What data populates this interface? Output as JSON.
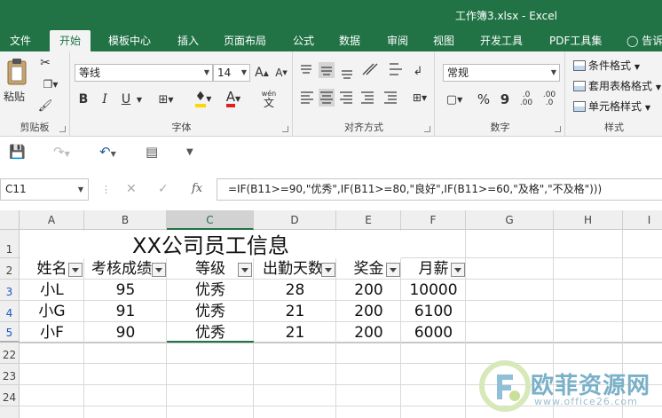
{
  "window": {
    "title": "工作簿3.xlsx - Excel"
  },
  "ribbon_tabs": [
    "文件",
    "开始",
    "模板中心",
    "插入",
    "页面布局",
    "公式",
    "数据",
    "审阅",
    "视图",
    "开发工具",
    "PDF工具集"
  ],
  "tell_me": "告诉",
  "clipboard": {
    "paste_label": "粘贴",
    "group_label": "剪贴板"
  },
  "font": {
    "name": "等线",
    "size": "14",
    "bold": "B",
    "italic": "I",
    "underline": "U",
    "font_color_glyph": "A",
    "wen": "wén",
    "wen_char": "文",
    "group_label": "字体"
  },
  "alignment": {
    "group_label": "对齐方式"
  },
  "number": {
    "format": "常规",
    "percent": "%",
    "comma": "9",
    "group_label": "数字"
  },
  "styles": {
    "conditional": "条件格式",
    "table": "套用表格格式",
    "cell": "单元格样式",
    "group_label": "样式"
  },
  "formula_bar": {
    "name_box": "C11",
    "fx": "fx",
    "formula": "=IF(B11>=90,\"优秀\",IF(B11>=80,\"良好\",IF(B11>=60,\"及格\",\"不及格\")))"
  },
  "columns": [
    "A",
    "B",
    "C",
    "D",
    "E",
    "F",
    "G",
    "H",
    "I"
  ],
  "rows": [
    "1",
    "2",
    "3",
    "4",
    "5",
    "22",
    "23",
    "24"
  ],
  "sheet": {
    "title": "XX公司员工信息",
    "headers": [
      "姓名",
      "考核成绩",
      "等级",
      "出勤天数",
      "奖金",
      "月薪"
    ],
    "data": [
      [
        "小L",
        "95",
        "优秀",
        "28",
        "200",
        "10000"
      ],
      [
        "小G",
        "91",
        "优秀",
        "21",
        "200",
        "6100"
      ],
      [
        "小F",
        "90",
        "优秀",
        "21",
        "200",
        "6000"
      ]
    ]
  },
  "watermark": {
    "name": "欧菲资源网",
    "url": "www.office26.com"
  },
  "colors": {
    "excel_green": "#217346",
    "filtered_row": "#1a56c8"
  }
}
